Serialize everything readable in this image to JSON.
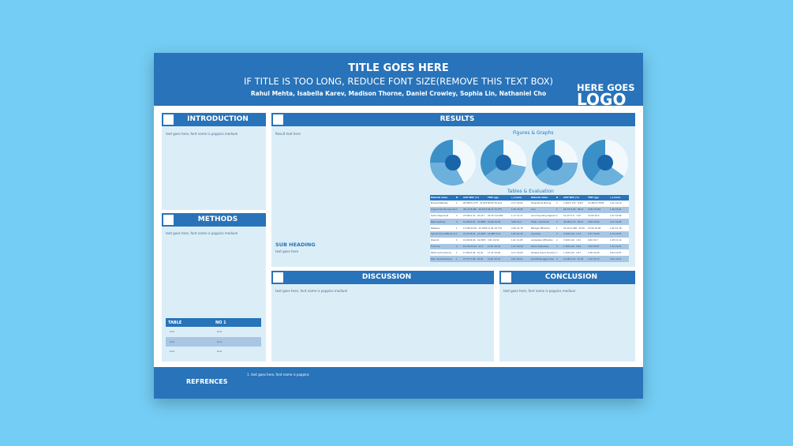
{
  "header": {
    "title": "TITLE GOES HERE",
    "subtitle": "IF TITLE IS TOO LONG, REDUCE FONT SIZE(REMOVE THIS TEXT BOX)",
    "authors": "Rahul Mehta, Isabella Karev, Madison Thorne, Daniel Crowley, Sophia Lin, Nathaniel Cho",
    "logo_line1": "HERE GOES",
    "logo_line2": "LOGO"
  },
  "introduction": {
    "heading": "INTRODUCTION",
    "body": "text goes here, font name is poppins medium"
  },
  "methods": {
    "heading": "METHODS",
    "body": "text goes here, font name is poppins medium",
    "table": {
      "headers": [
        "TABLE",
        "NO 1"
      ],
      "rows": [
        [
          "text",
          "text"
        ],
        [
          "text",
          "text"
        ],
        [
          "text",
          "text"
        ]
      ]
    }
  },
  "results": {
    "heading": "RESULTS",
    "body": "Result text here",
    "figures_title": "Figures & Graphs",
    "tables_title": "Tables & Evaluation",
    "subheading": "SUB HEADING",
    "sub_body": "text goes here",
    "table": {
      "headers": [
        "Material name",
        "N",
        "Artif WAC (%)",
        "TRW (µg)",
        "r_a (mm)",
        "Material name",
        "N",
        "Artif WAC (%)",
        "TRW (µg)",
        "r_a (mm)"
      ],
      "rows": [
        [
          "Mineral Materias",
          "1",
          "60.058±1.175 · 41.0453",
          "60.60 ±0.014",
          "0.17 ±0.02",
          "Projectional Moving",
          "3",
          "1.26±1.174 · 0.917",
          "72.48±11.5345",
          "1.21 ±0.14"
        ],
        [
          "Organochloride Associate",
          "2",
          "48.11±8.046 · 40.0115",
          "60.24 ±0.975",
          "1.09 ±0.95",
          "Acer",
          "2",
          "46.37±2.06 · 38.14",
          "4.98 ±0.042",
          "1.49 ±0.41"
        ],
        [
          "Sulfur Dispersoid",
          "3",
          "27.58±1.41 · 22.271",
          "93.76 ±12.082",
          "1.17 ±1.11",
          "Ionic-Ft-pouting Kapandino? & Stollan yosatasa",
          "2",
          "10.27±7.8 · 7.45",
          "13.60 ±0.4",
          "1.07 ±0.96"
        ],
        [
          "Base seedling",
          "4",
          "10.46±0.61 · 19.8989",
          "10.99 ±0.49",
          "4.66 ±4.3",
          "Tritiac, aluminium",
          "2",
          "44.49±1.43 · 49.17",
          "4.06 ±0.00",
          "4.11 ±4.95"
        ],
        [
          "Plateaus",
          "1",
          "17.58±10.45 · 25.7095",
          "11.04 ±0.776",
          "2.60 ±2.78",
          "Nitrogel diffraction",
          "1",
          "22.41±1.208 · 29.35",
          "15.00 ±0.46",
          "1.60 ±1.18"
        ],
        [
          "Cytochrome different series",
          "5",
          "21.47±8.91 · 13.4003",
          "10.088 ±1.8",
          "1.69 ±1.43",
          "Cyanides",
          "3",
          "3.44±1.29 · 1.73",
          "3.57 ±0.66",
          "0.74 ±0.97"
        ],
        [
          "Plasmid",
          "3",
          "19.04±6.00 · 19.0303",
          "3.81 ±0.54",
          "1.61 ±1.65",
          "Acetylated diffraction",
          "2",
          "3.20±1.09 · 1.51",
          "6.60 ±0.7",
          "1.38 ±1.14"
        ],
        [
          "Fluorines",
          "2",
          "15.75±12.43 · 9.17",
          "17.87 ±0.19",
          "1.07 ±0.19",
          "Silicon Sulfurides",
          "3",
          "1.30±1.06 · 0.94",
          "3.59 ±0.57",
          "1.32 ±1.01"
        ],
        [
          "Radio hydrocarbons",
          "1",
          "17.80±2.04 · 15.02",
          "17.32 ±0.84",
          "0.11 ±0.09",
          "Simplex size & Compound aldimines",
          "3",
          "1.34±1.00 · 0.97",
          "2.48 ±0.20",
          "0.43 ±0.97"
        ],
        [
          "Nitro dendrobaceous",
          "1",
          "27.17±7.88 · 16.94",
          "14.87 ±0.51",
          "0.87 ±0.01",
          "Duoclitrite aggre dose",
          "2",
          "21.26±1.91 · 10.20",
          "1.02 ±0.79",
          "0.91 ±0.31"
        ]
      ]
    },
    "pies": [
      {
        "name": "pie-chart-1",
        "slices": [
          0.42,
          0.33,
          0.25
        ]
      },
      {
        "name": "pie-chart-2",
        "slices": [
          0.28,
          0.37,
          0.35
        ]
      },
      {
        "name": "pie-chart-3",
        "slices": [
          0.25,
          0.4,
          0.35
        ]
      },
      {
        "name": "pie-chart-4",
        "slices": [
          0.35,
          0.25,
          0.4
        ]
      }
    ]
  },
  "discussion": {
    "heading": "DISCUSSION",
    "body": "text goes here, font name is poppins medium"
  },
  "conclusion": {
    "heading": "CONCLUSION",
    "body": "text goes here, font name is poppins medium"
  },
  "references": {
    "label": "REFRENCES",
    "item1": "1. text goes here, font name is poppins"
  },
  "colors": {
    "primary": "#2873b9",
    "panel": "#dbeef8",
    "background": "#74cdf4",
    "pie_light": "#f2f9fd",
    "pie_mid": "#6cb0dc",
    "pie_dark": "#3c90c8"
  }
}
